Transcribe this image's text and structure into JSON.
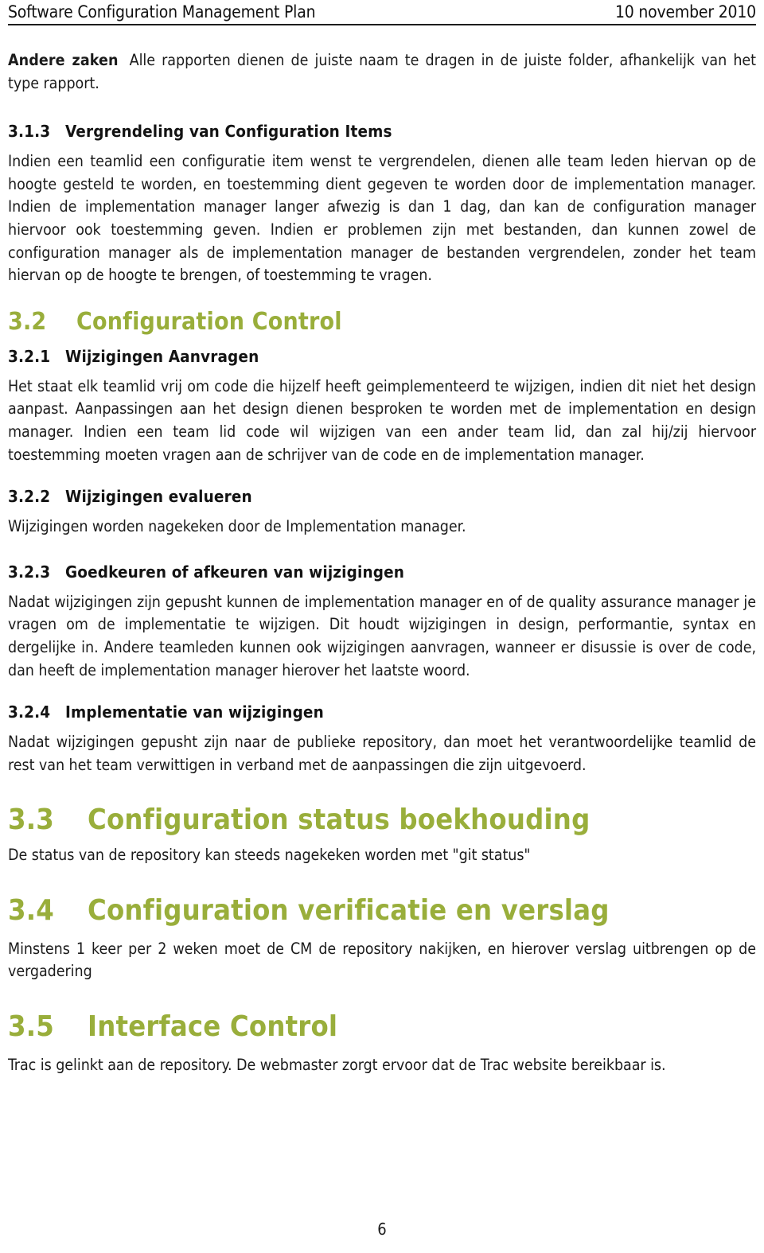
{
  "header": {
    "title": "Software Configuration Management Plan",
    "date": "10 november 2010"
  },
  "colors": {
    "heading_green": "#99ae3b",
    "body_text": "#1b1b1b",
    "rule": "#1d1d1d",
    "page_background": "#ffffff"
  },
  "blocks": {
    "andere_zaken": {
      "lead_in": "Andere zaken",
      "text": "Alle rapporten dienen de juiste naam te dragen in de juiste folder, afhankelijk van het type rapport."
    },
    "h_3_1_3": {
      "number": "3.1.3",
      "title": "Vergrendeling van Configuration Items"
    },
    "p_3_1_3": {
      "text": "Indien een teamlid een configuratie item wenst te vergrendelen, dienen alle team leden hiervan op de hoogte gesteld te worden, en toestemming dient gegeven te worden door de implementation manager. Indien de implementation manager langer afwezig is dan 1 dag, dan kan de configuration manager hiervoor ook toestemming geven. Indien er problemen zijn met bestanden, dan kunnen zowel de configuration manager als de implementation manager de bestanden vergrendelen, zonder het team hiervan op de hoogte te brengen, of toestemming te vragen."
    },
    "h_3_2": {
      "number": "3.2",
      "title": "Configuration Control"
    },
    "h_3_2_1": {
      "number": "3.2.1",
      "title": "Wijzigingen Aanvragen"
    },
    "p_3_2_1": {
      "text": "Het staat elk teamlid vrij om code die hijzelf heeft geimplementeerd te wijzigen, indien dit niet het design aanpast. Aanpassingen aan het design dienen besproken te worden met de implementation en design manager. Indien een team lid code wil wijzigen van een ander team lid, dan zal hij/zij hiervoor toestemming moeten vragen aan de schrijver van de code en de implementation manager."
    },
    "h_3_2_2": {
      "number": "3.2.2",
      "title": "Wijzigingen evalueren"
    },
    "p_3_2_2": {
      "text": "Wijzigingen worden nagekeken door de Implementation manager."
    },
    "h_3_2_3": {
      "number": "3.2.3",
      "title": "Goedkeuren of afkeuren van wijzigingen"
    },
    "p_3_2_3": {
      "text": "Nadat wijzigingen zijn gepusht kunnen de implementation manager en of de quality assurance manager je vragen om de implementatie te wijzigen. Dit houdt wijzigingen in design, performantie, syntax en dergelijke in. Andere teamleden kunnen ook wijzigingen aanvragen, wanneer er disussie is over de code, dan heeft de implementation manager hierover het laatste woord."
    },
    "h_3_2_4": {
      "number": "3.2.4",
      "title": "Implementatie van wijzigingen"
    },
    "p_3_2_4": {
      "text": "Nadat wijzigingen gepusht zijn naar de publieke repository, dan moet het verantwoordelijke teamlid de rest van het team verwittigen in verband met de aanpassingen die zijn uitgevoerd."
    },
    "h_3_3": {
      "number": "3.3",
      "title": "Configuration status boekhouding"
    },
    "p_3_3": {
      "text": "De status van de repository kan steeds nagekeken worden met \"git status\""
    },
    "h_3_4": {
      "number": "3.4",
      "title": "Configuration verificatie en verslag"
    },
    "p_3_4": {
      "text": "Minstens 1 keer per 2 weken moet de CM de repository nakijken, en hierover verslag uitbrengen op de vergadering"
    },
    "h_3_5": {
      "number": "3.5",
      "title": "Interface Control"
    },
    "p_3_5": {
      "text": "Trac is gelinkt aan de repository. De webmaster zorgt ervoor dat de Trac website bereikbaar is."
    }
  },
  "footer": {
    "page_number": "6"
  }
}
